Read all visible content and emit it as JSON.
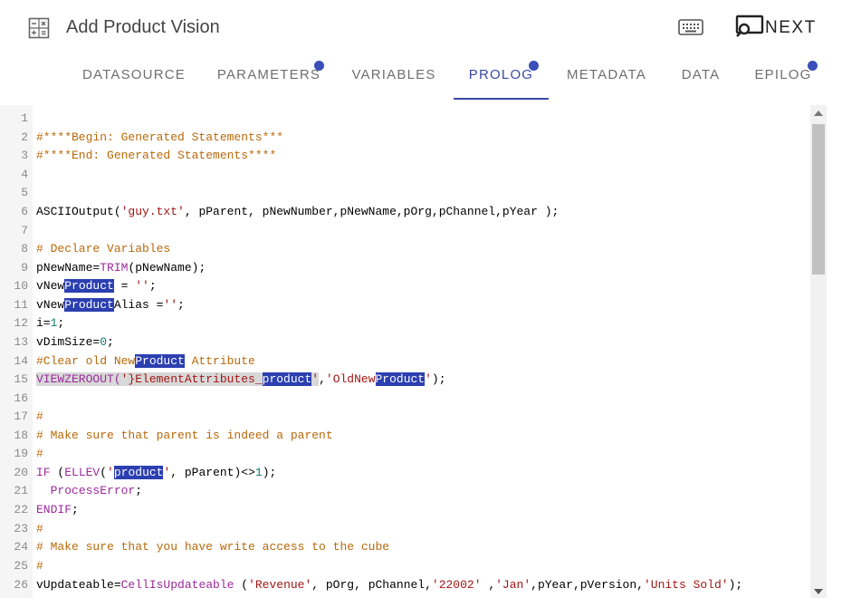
{
  "header": {
    "title": "Add Product Vision",
    "icons": {
      "left": "calculator-icon",
      "keyboard": "keyboard-icon",
      "next": "screen-search-icon"
    },
    "next_label": "NEXT"
  },
  "tabs": [
    {
      "label": "DATASOURCE",
      "dot": false,
      "active": false
    },
    {
      "label": "PARAMETERS",
      "dot": true,
      "active": false
    },
    {
      "label": "VARIABLES",
      "dot": false,
      "active": false
    },
    {
      "label": "PROLOG",
      "dot": true,
      "active": true
    },
    {
      "label": "METADATA",
      "dot": false,
      "active": false
    },
    {
      "label": "DATA",
      "dot": false,
      "active": false
    },
    {
      "label": "EPILOG",
      "dot": true,
      "active": false
    }
  ],
  "colors": {
    "accent": "#3a4aa6",
    "dot": "#3a4fb8",
    "comment": "#b8690a",
    "string": "#a31515",
    "function": "#9b2a9b",
    "number": "#0b7a6b",
    "highlight": "#2b3fb0"
  },
  "editor": {
    "lines": [
      {
        "n": "1",
        "segs": []
      },
      {
        "n": "2",
        "segs": [
          {
            "t": "#****Begin: Generated Statements***",
            "c": "cm"
          }
        ]
      },
      {
        "n": "3",
        "segs": [
          {
            "t": "#****End: Generated Statements****",
            "c": "cm"
          }
        ]
      },
      {
        "n": "4",
        "segs": []
      },
      {
        "n": "5",
        "segs": []
      },
      {
        "n": "6",
        "segs": [
          {
            "t": "ASCIIOutput("
          },
          {
            "t": "'guy.txt'",
            "c": "str"
          },
          {
            "t": ", pParent, pNewNumber,pNewName,pOrg,pChannel,pYear );"
          }
        ]
      },
      {
        "n": "7",
        "segs": []
      },
      {
        "n": "8",
        "segs": [
          {
            "t": "# Declare Variables",
            "c": "cm"
          }
        ]
      },
      {
        "n": "9",
        "segs": [
          {
            "t": "pNewName="
          },
          {
            "t": "TRIM",
            "c": "fn"
          },
          {
            "t": "(pNewName);"
          }
        ]
      },
      {
        "n": "10",
        "segs": [
          {
            "t": "vNew"
          },
          {
            "t": "Product",
            "c": "hl"
          },
          {
            "t": " = "
          },
          {
            "t": "''",
            "c": "str"
          },
          {
            "t": ";"
          }
        ]
      },
      {
        "n": "11",
        "segs": [
          {
            "t": "vNew"
          },
          {
            "t": "Product",
            "c": "hl"
          },
          {
            "t": "Alias ="
          },
          {
            "t": "''",
            "c": "str"
          },
          {
            "t": ";"
          }
        ]
      },
      {
        "n": "12",
        "segs": [
          {
            "t": "i="
          },
          {
            "t": "1",
            "c": "num"
          },
          {
            "t": ";"
          }
        ]
      },
      {
        "n": "13",
        "segs": [
          {
            "t": "vDimSize="
          },
          {
            "t": "0",
            "c": "num"
          },
          {
            "t": ";"
          }
        ]
      },
      {
        "n": "14",
        "segs": [
          {
            "t": "#Clear old New",
            "c": "cm"
          },
          {
            "t": "Product",
            "c": "hl"
          },
          {
            "t": " Attribute",
            "c": "cm"
          }
        ]
      },
      {
        "n": "15",
        "segs": [
          {
            "t": "VIEWZEROOUT(",
            "c": "fn sel"
          },
          {
            "t": "'}ElementAttributes_",
            "c": "str sel"
          },
          {
            "t": "product",
            "c": "hl"
          },
          {
            "t": "'",
            "c": "str sel"
          },
          {
            "t": ","
          },
          {
            "t": "'OldNew",
            "c": "str"
          },
          {
            "t": "Product",
            "c": "hl"
          },
          {
            "t": "'",
            "c": "str"
          },
          {
            "t": ");"
          }
        ]
      },
      {
        "n": "16",
        "segs": []
      },
      {
        "n": "17",
        "segs": [
          {
            "t": "#",
            "c": "cm"
          }
        ]
      },
      {
        "n": "18",
        "segs": [
          {
            "t": "# Make sure that parent is indeed a parent",
            "c": "cm"
          }
        ]
      },
      {
        "n": "19",
        "segs": [
          {
            "t": "#",
            "c": "cm"
          }
        ]
      },
      {
        "n": "20",
        "segs": [
          {
            "t": "IF",
            "c": "fn"
          },
          {
            "t": " ("
          },
          {
            "t": "ELLEV",
            "c": "fn"
          },
          {
            "t": "("
          },
          {
            "t": "'",
            "c": "str"
          },
          {
            "t": "product",
            "c": "hl"
          },
          {
            "t": "'",
            "c": "str"
          },
          {
            "t": ", pParent)<>"
          },
          {
            "t": "1",
            "c": "num"
          },
          {
            "t": ");"
          }
        ]
      },
      {
        "n": "21",
        "segs": [
          {
            "t": "  "
          },
          {
            "t": "ProcessError",
            "c": "fn"
          },
          {
            "t": ";"
          }
        ]
      },
      {
        "n": "22",
        "segs": [
          {
            "t": "ENDIF",
            "c": "fn"
          },
          {
            "t": ";"
          }
        ]
      },
      {
        "n": "23",
        "segs": [
          {
            "t": "#",
            "c": "cm"
          }
        ]
      },
      {
        "n": "24",
        "segs": [
          {
            "t": "# Make sure that you have write access to the cube",
            "c": "cm"
          }
        ]
      },
      {
        "n": "25",
        "segs": [
          {
            "t": "#",
            "c": "cm"
          }
        ]
      },
      {
        "n": "26",
        "segs": [
          {
            "t": "vUpdateable="
          },
          {
            "t": "CellIsUpdateable",
            "c": "fn"
          },
          {
            "t": " ("
          },
          {
            "t": "'Revenue'",
            "c": "str"
          },
          {
            "t": ", pOrg, pChannel,"
          },
          {
            "t": "'22002'",
            "c": "str"
          },
          {
            "t": " ,"
          },
          {
            "t": "'Jan'",
            "c": "str"
          },
          {
            "t": ",pYear,pVersion,"
          },
          {
            "t": "'Units Sold'",
            "c": "str"
          },
          {
            "t": ");"
          }
        ]
      }
    ]
  }
}
